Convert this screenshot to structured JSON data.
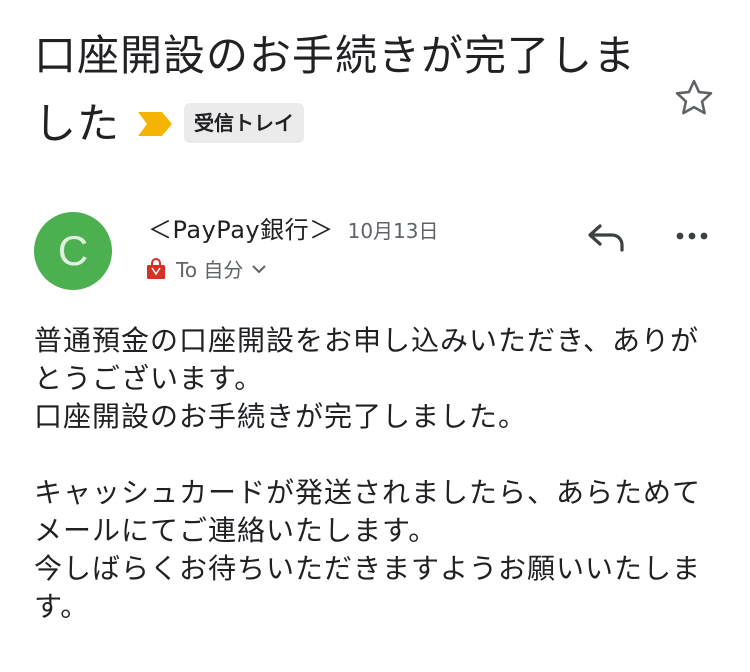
{
  "email": {
    "subject": "口座開設のお手続きが完了しました",
    "label": "受信トレイ",
    "sender": {
      "avatar_letter": "C",
      "name": "＜PayPay銀行＞",
      "date": "10月13日"
    },
    "recipient": "To 自分",
    "body": {
      "paragraph1": "普通預金の口座開設をお申し込みいただき、ありがとうございます。\n口座開設のお手続きが完了しました。",
      "paragraph2": "キャッシュカードが発送されましたら、あらためてメールにてご連絡いたします。\n今しばらくお待ちいただきますようお願いいたします。"
    }
  },
  "icons": {
    "importance": "importance-marker-icon",
    "star": "star-icon",
    "reply": "reply-icon",
    "more": "more-options-icon",
    "shopping": "shopping-bag-icon",
    "chevron": "chevron-down-icon"
  },
  "colors": {
    "importance": "#f4b400",
    "avatar": "#4caf50",
    "shopping_bag": "#d93025",
    "label_chip_bg": "#ebebeb"
  }
}
